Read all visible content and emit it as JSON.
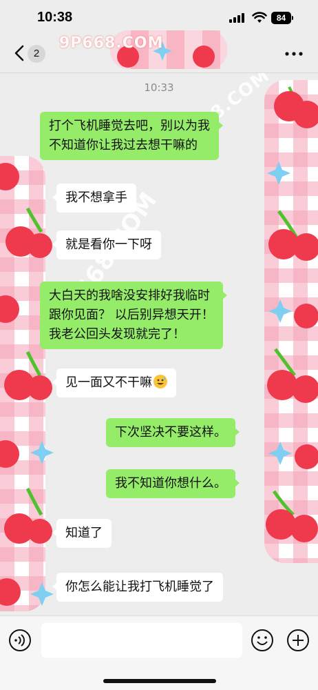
{
  "status_bar": {
    "time": "10:38",
    "battery": "84"
  },
  "nav": {
    "unread_count": "2",
    "watermark_top": "9P668.COM"
  },
  "chat": {
    "timestamp": "10:33",
    "watermark_diag_1": "9P668.COM",
    "watermark_diag_2": "9P668.COM",
    "messages": [
      {
        "side": "sent",
        "lines": [
          "打个飞机睡觉去吧，别以为我",
          "不知道你让我过去想干嘛的"
        ]
      },
      {
        "side": "recv",
        "lines": [
          "我不想拿手"
        ]
      },
      {
        "side": "recv",
        "lines": [
          "就是看你一下呀"
        ]
      },
      {
        "side": "sent",
        "lines": [
          "大白天的我啥没安排好我临时",
          "跟你见面？ 以后别异想天开！",
          "我老公回头发现就完了！"
        ]
      },
      {
        "side": "recv",
        "lines": [
          "见一面又不干嘛"
        ],
        "emoji": "grinning-sweat-emoji"
      },
      {
        "side": "sent",
        "lines": [
          "下次坚决不要这样。"
        ]
      },
      {
        "side": "sent",
        "lines": [
          "我不知道你想什么。"
        ]
      },
      {
        "side": "recv",
        "lines": [
          "知道了"
        ]
      },
      {
        "side": "recv",
        "lines": [
          "你怎么能让我打飞机睡觉了"
        ]
      }
    ]
  },
  "input_bar": {
    "placeholder": "",
    "icons": [
      "voice-icon",
      "emoji-icon",
      "plus-icon"
    ]
  },
  "colors": {
    "background": "#ededed",
    "sent_bubble": "#95ec69",
    "recv_bubble": "#ffffff",
    "pattern_pink": "#f6a0b4",
    "cherry_red": "#ee3a4c",
    "leaf_green": "#4fc22e",
    "star_blue": "#7fcff2"
  }
}
